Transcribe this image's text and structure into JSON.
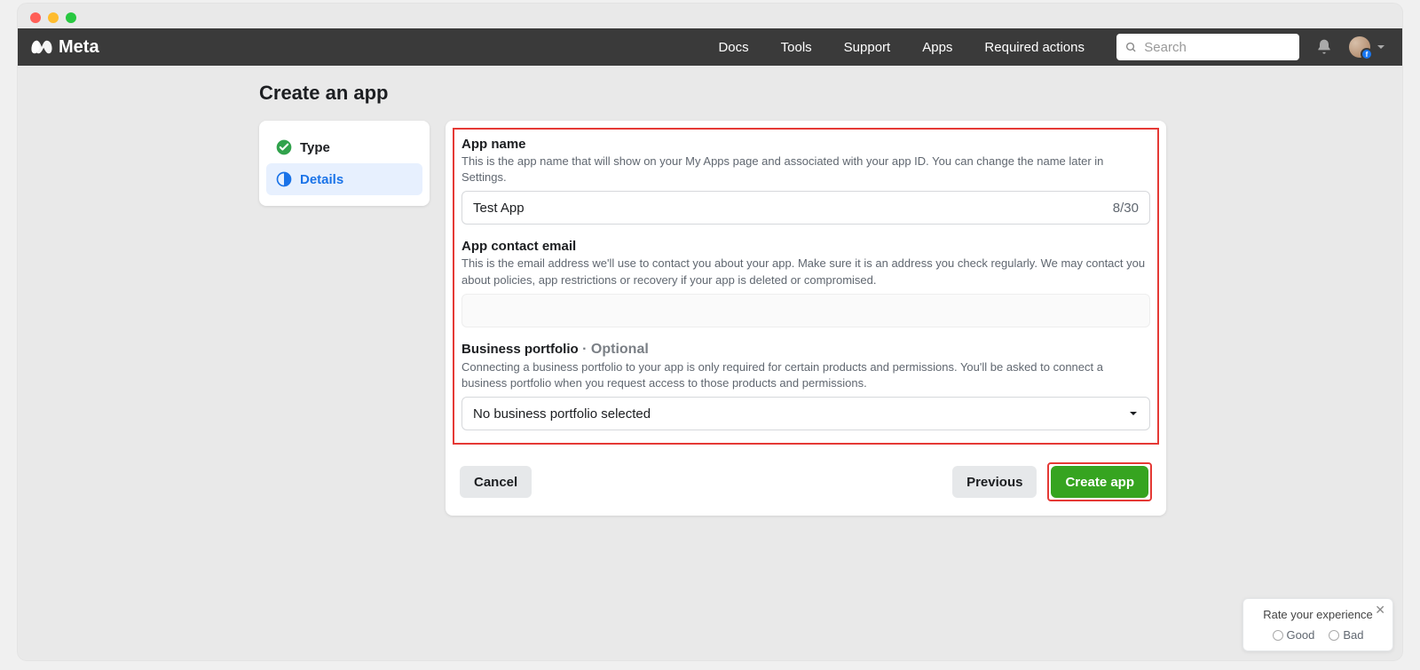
{
  "brand": "Meta",
  "nav": {
    "docs": "Docs",
    "tools": "Tools",
    "support": "Support",
    "apps": "Apps",
    "required": "Required actions"
  },
  "search": {
    "placeholder": "Search"
  },
  "page": {
    "title": "Create an app"
  },
  "steps": {
    "type": "Type",
    "details": "Details"
  },
  "form": {
    "appName": {
      "label": "App name",
      "help": "This is the app name that will show on your My Apps page and associated with your app ID. You can change the name later in Settings.",
      "value": "Test App",
      "count": "8/30"
    },
    "email": {
      "label": "App contact email",
      "help": "This is the email address we'll use to contact you about your app. Make sure it is an address you check regularly. We may contact you about policies, app restrictions or recovery if your app is deleted or compromised."
    },
    "portfolio": {
      "label": "Business portfolio",
      "optional": " · Optional",
      "help": "Connecting a business portfolio to your app is only required for certain products and permissions. You'll be asked to connect a business portfolio when you request access to those products and permissions.",
      "selected": "No business portfolio selected"
    }
  },
  "buttons": {
    "cancel": "Cancel",
    "previous": "Previous",
    "create": "Create app"
  },
  "feedback": {
    "title": "Rate your experience",
    "good": "Good",
    "bad": "Bad"
  }
}
